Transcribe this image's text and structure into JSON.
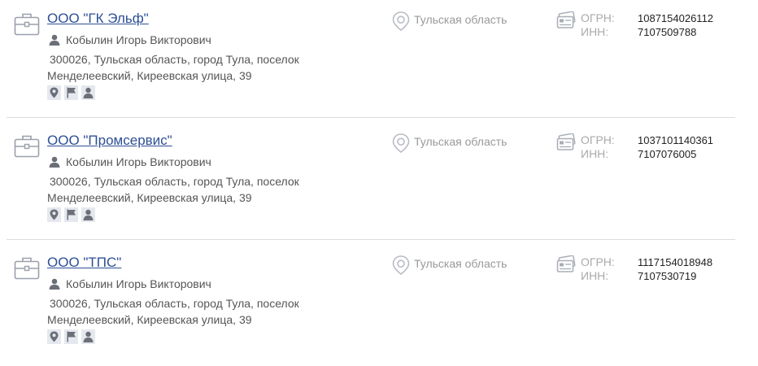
{
  "companies": [
    {
      "name": "ООО \"ГК Эльф\"",
      "director": "Кобылин Игорь Викторович",
      "address": "300026, Тульская область, город Тула, поселок Менделеевский, Киреевская улица, 39",
      "region": "Тульская область",
      "ogrn_label": "ОГРН:",
      "ogrn": "1087154026112",
      "inn_label": "ИНН:",
      "inn": "7107509788"
    },
    {
      "name": "ООО \"Промсервис\"",
      "director": "Кобылин Игорь Викторович",
      "address": "300026, Тульская область, город Тула, поселок Менделеевский, Киреевская улица, 39",
      "region": "Тульская область",
      "ogrn_label": "ОГРН:",
      "ogrn": "1037101140361",
      "inn_label": "ИНН:",
      "inn": "7107076005"
    },
    {
      "name": "ООО \"ТПС\"",
      "director": "Кобылин Игорь Викторович",
      "address": "300026, Тульская область, город Тула, поселок Менделеевский, Киреевская улица, 39",
      "region": "Тульская область",
      "ogrn_label": "ОГРН:",
      "ogrn": "1117154018948",
      "inn_label": "ИНН:",
      "inn": "7107530719"
    }
  ],
  "icons": {
    "company": "briefcase-icon",
    "director": "person-icon",
    "badges": [
      "map-pin-icon",
      "flag-icon",
      "person-icon"
    ],
    "region": "location-pin-icon",
    "registration": "id-card-icon"
  },
  "colors": {
    "link": "#2d4f96",
    "text": "#555555",
    "muted": "#999999",
    "value": "#222222",
    "badge_bg": "#e6e8ef",
    "icon": "#7a8090",
    "divider": "#dcdcdc"
  }
}
